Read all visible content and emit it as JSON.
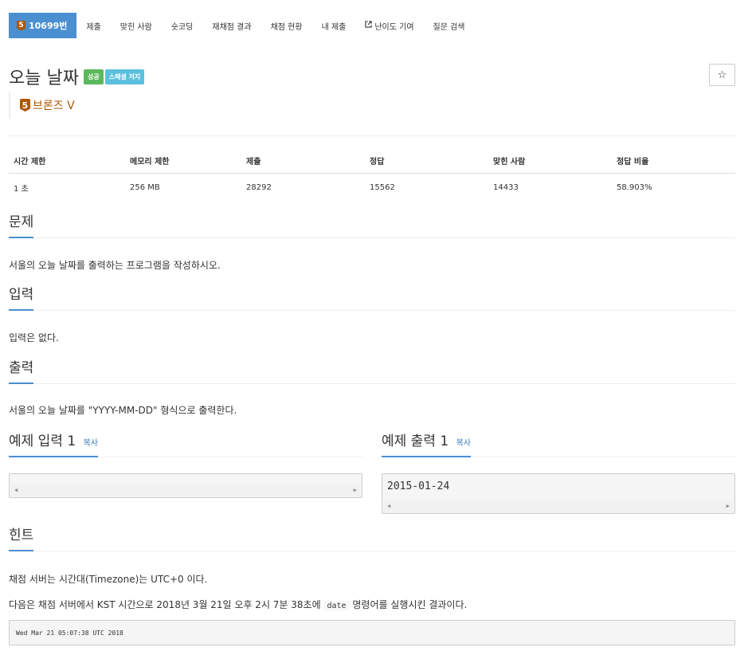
{
  "nav": {
    "problem_badge": "5",
    "problem_number": "10699번",
    "items": [
      "제출",
      "맞힌 사람",
      "숏코딩",
      "재채점 결과",
      "채점 현황",
      "내 제출",
      "난이도 기여",
      "질문 검색"
    ]
  },
  "problem": {
    "title": "오늘 날짜",
    "labels": [
      "성공",
      "스페셜 저지"
    ],
    "star": "☆",
    "tier_badge": "5",
    "tier_name": "브론즈 V"
  },
  "info_table": {
    "headers": [
      "시간 제한",
      "메모리 제한",
      "제출",
      "정답",
      "맞힌 사람",
      "정답 비율"
    ],
    "values": [
      "1 초",
      "256 MB",
      "28292",
      "15562",
      "14433",
      "58.903%"
    ]
  },
  "sections": {
    "description": {
      "title": "문제",
      "text": "서울의 오늘 날짜를 출력하는 프로그램을 작성하시오."
    },
    "input": {
      "title": "입력",
      "text": "입력은 없다."
    },
    "output": {
      "title": "출력",
      "text": "서울의 오늘 날짜를 \"YYYY-MM-DD\" 형식으로 출력한다."
    },
    "sample_input": {
      "title": "예제 입력 1",
      "copy": "복사",
      "content": ""
    },
    "sample_output": {
      "title": "예제 출력 1",
      "copy": "복사",
      "content": "2015-01-24"
    },
    "hint": {
      "title": "힌트",
      "line1": "채점 서버는 시간대(Timezone)는 UTC+0 이다.",
      "line2_before": "다음은 채점 서버에서 KST 시간으로 2018년 3월 21일 오후 2시 7분 38초에",
      "line2_code": "date",
      "line2_after": "명령어를 실행시킨 결과이다.",
      "command_output": "Wed Mar 21 05:07:38 UTC 2018"
    }
  },
  "colors": {
    "accent": "#4a8fd0",
    "bronze": "#ad5600",
    "success": "#5cb85c",
    "info": "#5bc0de",
    "link": "#337ab7"
  }
}
